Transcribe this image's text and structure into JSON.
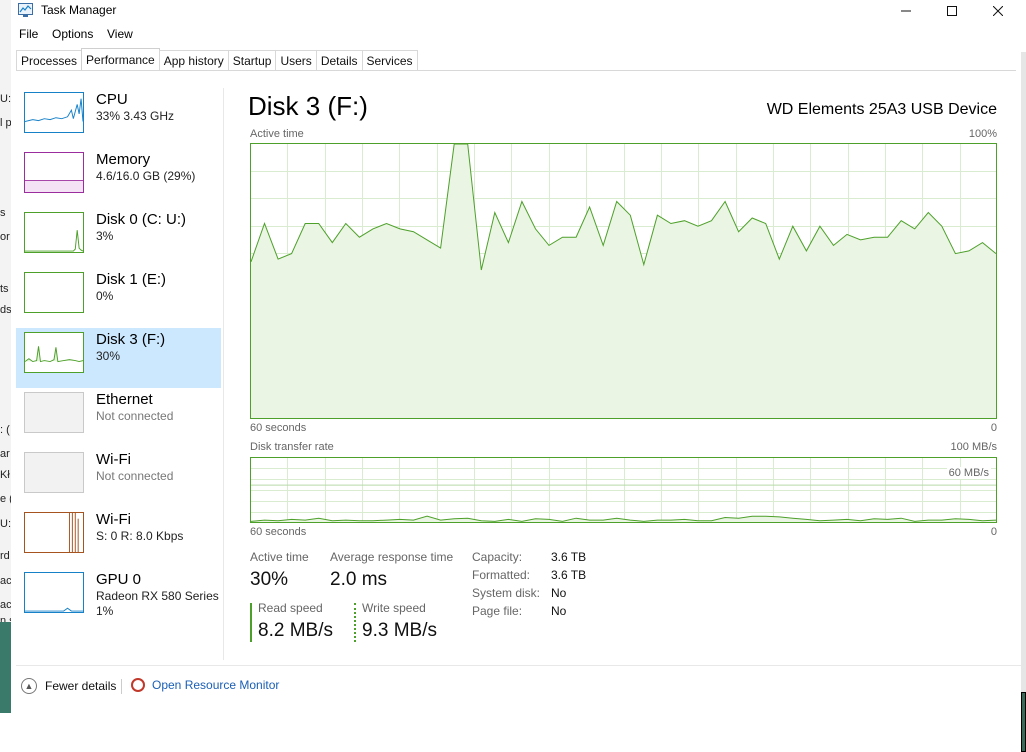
{
  "window": {
    "title": "Task Manager"
  },
  "menu": [
    "File",
    "Options",
    "View"
  ],
  "tabs": [
    "Processes",
    "Performance",
    "App history",
    "Startup",
    "Users",
    "Details",
    "Services"
  ],
  "active_tab": "Performance",
  "sidebar": [
    {
      "name": "CPU",
      "line1": "33% 3.43 GHz",
      "line2": "",
      "color": "#1781c8"
    },
    {
      "name": "Memory",
      "line1": "4.6/16.0 GB (29%)",
      "line2": "",
      "color": "#9b2d9e"
    },
    {
      "name": "Disk 0 (C: U:)",
      "line1": "3%",
      "line2": "",
      "color": "#4da02a"
    },
    {
      "name": "Disk 1 (E:)",
      "line1": "0%",
      "line2": "",
      "color": "#4da02a"
    },
    {
      "name": "Disk 3 (F:)",
      "line1": "30%",
      "line2": "",
      "color": "#4da02a",
      "selected": true
    },
    {
      "name": "Ethernet",
      "line1": "Not connected",
      "line2": "",
      "color": "#c9c9c9",
      "muted": true
    },
    {
      "name": "Wi-Fi",
      "line1": "Not connected",
      "line2": "",
      "color": "#c9c9c9",
      "muted": true
    },
    {
      "name": "Wi-Fi",
      "line1": "S: 0 R: 8.0 Kbps",
      "line2": "",
      "color": "#a7531f"
    },
    {
      "name": "GPU 0",
      "line1": "Radeon RX 580 Series",
      "line2": "1%",
      "color": "#1781c8"
    }
  ],
  "detail": {
    "title": "Disk 3 (F:)",
    "device": "WD Elements 25A3 USB Device",
    "active_time_label": "Active time",
    "active_time_max": "100%",
    "graph_time_left": "60 seconds",
    "graph_time_right": "0",
    "transfer_label": "Disk transfer rate",
    "transfer_max": "100 MB/s",
    "transfer_mark": "60 MB/s",
    "stats": {
      "active_time_label": "Active time",
      "active_time_value": "30%",
      "avg_response_label": "Average response time",
      "avg_response_value": "2.0 ms",
      "read_label": "Read speed",
      "read_value": "8.2 MB/s",
      "write_label": "Write speed",
      "write_value": "9.3 MB/s"
    },
    "properties": [
      {
        "key": "Capacity:",
        "value": "3.6 TB"
      },
      {
        "key": "Formatted:",
        "value": "3.6 TB"
      },
      {
        "key": "System disk:",
        "value": "No"
      },
      {
        "key": "Page file:",
        "value": "No"
      }
    ]
  },
  "active_time_series": [
    57,
    71,
    58,
    60,
    71,
    71,
    64,
    71,
    66,
    69,
    71,
    69,
    68,
    65,
    62,
    100,
    100,
    54,
    75,
    64,
    79,
    69,
    63,
    66,
    66,
    77,
    63,
    79,
    74,
    56,
    74,
    71,
    72,
    70,
    72,
    79,
    68,
    73,
    71,
    58,
    70,
    61,
    70,
    63,
    67,
    65,
    66,
    66,
    72,
    69,
    75,
    70,
    60,
    61,
    64,
    60
  ],
  "transfer_series": [
    1,
    3,
    2,
    4,
    3,
    6,
    2,
    3,
    2,
    2,
    3,
    4,
    3,
    9,
    3,
    5,
    6,
    2,
    1,
    4,
    1,
    5,
    4,
    1,
    6,
    3,
    3,
    6,
    3,
    1,
    3,
    3,
    4,
    2,
    2,
    7,
    6,
    9,
    9,
    8,
    6,
    4,
    2,
    3,
    4,
    2,
    5,
    4,
    6,
    1,
    3,
    3,
    5,
    4,
    2,
    3
  ],
  "footer": {
    "fewer_details": "Fewer details",
    "resource_monitor": "Open Resource Monitor"
  },
  "accent": "#4da02a",
  "selection": "#cce8ff"
}
